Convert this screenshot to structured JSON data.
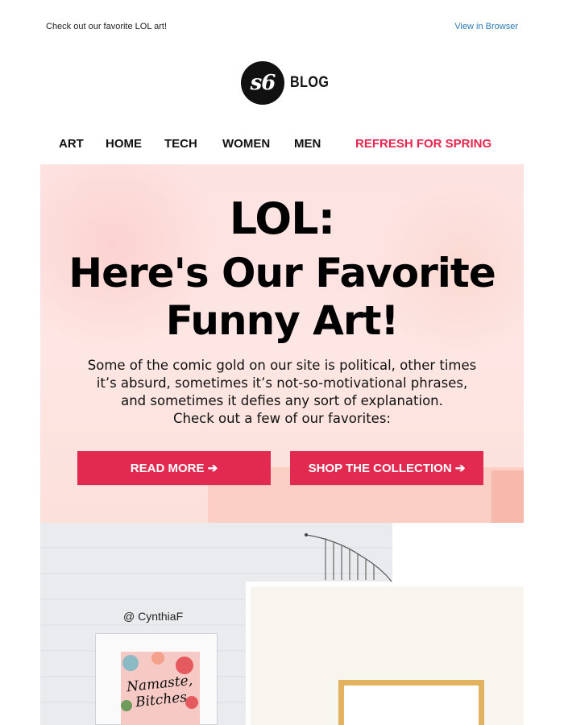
{
  "header": {
    "preheader": "Check out our favorite LOL art!",
    "view_in_browser": "View in Browser"
  },
  "logo": {
    "mark": "s6",
    "text": "BLOG"
  },
  "nav": {
    "items": [
      "ART",
      "HOME",
      "TECH",
      "WOMEN",
      "MEN"
    ],
    "highlight": "REFRESH FOR SPRING",
    "highlight_color": "#e8254e"
  },
  "hero": {
    "kicker": "LOL:",
    "title_line1": "Here's Our Favorite",
    "title_line2": "Funny Art!",
    "body_line1": "Some of the comic gold on our site is political, other times",
    "body_line2": "it’s absurd, sometimes it’s not-so-motivational phrases,",
    "body_line3": "and sometimes it defies any sort of explanation.",
    "body_line4": "Check out a few of our favorites:",
    "button_read_more": "READ MORE ➔",
    "button_shop": "SHOP THE COLLECTION ➔",
    "button_color": "#e2294f",
    "background_color": "#fde2e2"
  },
  "photos": {
    "credit": "@ CynthiaF",
    "print_text_line1": "Namaste,",
    "print_text_line2": "Bitches"
  }
}
